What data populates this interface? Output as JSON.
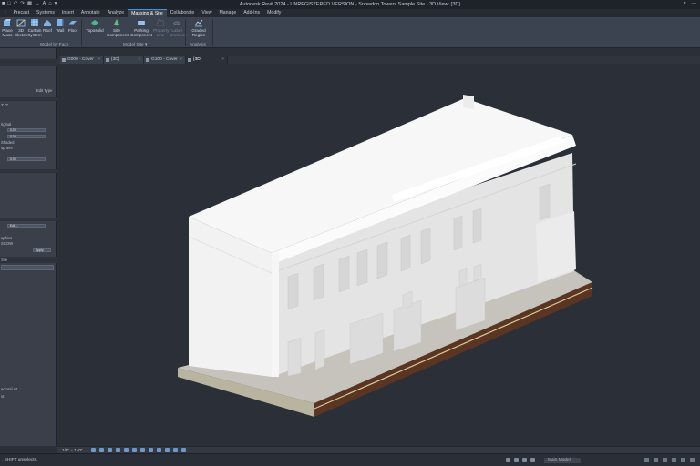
{
  "titlebar": {
    "title": "Autodesk Revit 2024 - UNREGISTERED VERSION - Snowdon Towers Sample Site - 3D View: {3D}",
    "account": "▾"
  },
  "tabs": [
    "t",
    "Precast",
    "Systems",
    "Insert",
    "Annotate",
    "Analyze",
    "Massing & Site",
    "Collaborate",
    "View",
    "Manage",
    "Add-Ins",
    "Modify"
  ],
  "active_tab": "Massing & Site",
  "ribbon": {
    "model_by_face": {
      "label": "Model by Face",
      "buttons": [
        "Place Mass",
        "3D Sketch",
        "Curtain System",
        "Roof",
        "Wall",
        "Floor"
      ]
    },
    "model_site": {
      "label": "Model Site ▾",
      "buttons": [
        "Toposolid",
        "Site Component",
        "Parking Component",
        "Property Line",
        "Label Contours"
      ]
    },
    "analysis": {
      "label": "Analysis",
      "buttons": [
        "Graded Region"
      ]
    }
  },
  "left_panel": {
    "edit_type": "Edit Type",
    "lines": [
      "3' 0\"",
      "riginal",
      "0.00",
      "0.00",
      "Shaded",
      "sphere",
      "0.00",
      "Edit...",
      "aphics",
      "SCOW",
      "Apply",
      "Site",
      "ectural.rvt",
      "vt"
    ]
  },
  "view_tabs": [
    {
      "label": "G000 - Cover"
    },
    {
      "label": "{3D}"
    },
    {
      "label": "G100 - Cover"
    },
    {
      "label": "{3D}"
    }
  ],
  "viewbar": {
    "scale": "1/8\" = 1'-0\""
  },
  "statusbar": {
    "message": ", SHIFT unselects.",
    "model_label": "Main Model"
  }
}
